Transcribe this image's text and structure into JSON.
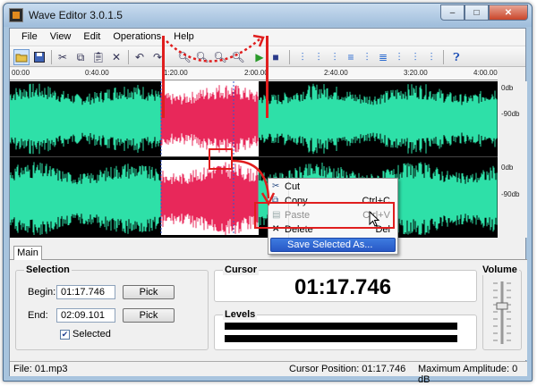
{
  "window": {
    "title": "Wave Editor 3.0.1.5",
    "min": "–",
    "max": "□",
    "close": "✕"
  },
  "menu": [
    "File",
    "View",
    "Edit",
    "Operations",
    "Help"
  ],
  "toolbar": {
    "icons": [
      "open-icon",
      "save-icon",
      "cut-icon",
      "copy-icon",
      "paste-icon",
      "delete-icon",
      "undo-icon",
      "redo-icon",
      "zoom-in-icon",
      "zoom-out-icon",
      "zoom-fit-icon",
      "play-icon",
      "stop-icon",
      "fade-in-icon",
      "fade-out-icon",
      "normalize-icon",
      "amplify-icon",
      "silence-icon",
      "reverse-icon",
      "invert-icon",
      "echo-icon",
      "effects-icon",
      "help-icon"
    ]
  },
  "ruler": {
    "labels": [
      "00:00",
      "0:40.00",
      "1:20.00",
      "2:00.00",
      "2:40.00",
      "3:20.00",
      "4:00.00"
    ]
  },
  "db_scale": {
    "labels": [
      "0db",
      "-90db",
      "0db",
      "-90db"
    ]
  },
  "colors": {
    "wave_normal": "#2ee0a8",
    "wave_selected": "#e8285a",
    "selection_bg": "#ffffff",
    "accent_red": "#e01e1e",
    "highlight": "#3163d6"
  },
  "selection_ratio": {
    "start": 0.31,
    "end": 0.51
  },
  "context_menu": {
    "items": [
      {
        "icon": "cut-icon",
        "label": "Cut",
        "shortcut": "",
        "disabled": false
      },
      {
        "icon": "copy-icon",
        "label": "Copy",
        "shortcut": "Ctrl+C",
        "disabled": false
      },
      {
        "icon": "paste-icon",
        "label": "Paste",
        "shortcut": "Ctrl+V",
        "disabled": true
      },
      {
        "icon": "delete-icon",
        "label": "Delete",
        "shortcut": "Del",
        "disabled": false
      },
      {
        "icon": "",
        "label": "Save Selected As...",
        "shortcut": "",
        "disabled": false
      }
    ]
  },
  "tab": "Main",
  "selection": {
    "title": "Selection",
    "begin_label": "Begin:",
    "begin_value": "01:17.746",
    "end_label": "End:",
    "end_value": "02:09.101",
    "pick_label": "Pick",
    "selected_label": "Selected",
    "selected_checked": true
  },
  "cursor": {
    "title": "Cursor",
    "value": "01:17.746"
  },
  "levels": {
    "title": "Levels"
  },
  "volume": {
    "title": "Volume"
  },
  "status": {
    "file": "File: 01.mp3",
    "cursor_position": "Cursor Position: 01:17.746",
    "max_amplitude": "Maximum Amplitude: 0 dB"
  }
}
